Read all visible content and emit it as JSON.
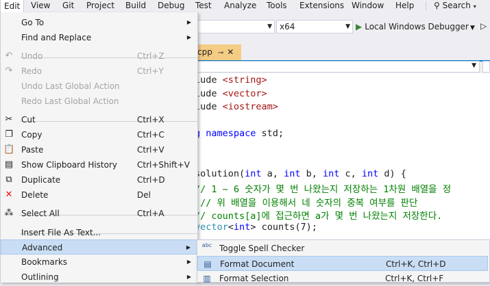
{
  "menubar": {
    "items": [
      "Edit",
      "View",
      "Git",
      "Project",
      "Build",
      "Debug",
      "Test",
      "Analyze",
      "Tools",
      "Extensions",
      "Window",
      "Help"
    ],
    "search": "Search"
  },
  "toolbar": {
    "config_value": "",
    "platform_value": "x64",
    "debugger_label": "Local Windows Debugger"
  },
  "editor": {
    "tab_label": "cpp",
    "code_lines": [
      {
        "parts": [
          [
            "",
            "lude "
          ],
          [
            "str",
            "<string>"
          ]
        ]
      },
      {
        "parts": [
          [
            "",
            "lude "
          ],
          [
            "str",
            "<vector>"
          ]
        ]
      },
      {
        "parts": [
          [
            "",
            "lude "
          ],
          [
            "str",
            "<iostream>"
          ]
        ]
      },
      {
        "parts": []
      },
      {
        "parts": [
          [
            "kw",
            "g namespace "
          ],
          [
            "",
            "std;"
          ]
        ]
      },
      {
        "parts": []
      },
      {
        "parts": []
      },
      {
        "parts": [
          [
            "",
            "solution("
          ],
          [
            "kw",
            "int"
          ],
          [
            "",
            " a, "
          ],
          [
            "kw",
            "int"
          ],
          [
            "",
            " b, "
          ],
          [
            "kw",
            "int"
          ],
          [
            "",
            " c, "
          ],
          [
            "kw",
            "int"
          ],
          [
            "",
            " d) {"
          ]
        ]
      },
      {
        "parts": [
          [
            "cm",
            "// 1 ~ 6 숫자가 몇 번 나왔는지 저장하는 1차원 배열을 정"
          ]
        ]
      },
      {
        "parts": [
          [
            "cm",
            " // 위 배열을 이용해서 네 숫자의 중복 여부를 판단"
          ]
        ]
      },
      {
        "parts": [
          [
            "cm",
            "// counts[a]에 접근하면 a가 몇 번 나왔는지 저장한다."
          ]
        ]
      },
      {
        "parts": [
          [
            "tp",
            "vector"
          ],
          [
            "",
            "<"
          ],
          [
            "kw",
            "int"
          ],
          [
            "",
            "> counts(7);"
          ]
        ]
      }
    ]
  },
  "edit_menu": {
    "items": [
      {
        "label": "Go To",
        "shortcut": "",
        "submenu": true,
        "icon": "",
        "disabled": false
      },
      {
        "label": "Find and Replace",
        "shortcut": "",
        "submenu": true,
        "icon": "",
        "disabled": false
      },
      {
        "label": "Undo",
        "shortcut": "Ctrl+Z",
        "submenu": false,
        "icon": "undo-icon",
        "disabled": true
      },
      {
        "label": "Redo",
        "shortcut": "Ctrl+Y",
        "submenu": false,
        "icon": "redo-icon",
        "disabled": true
      },
      {
        "label": "Undo Last Global Action",
        "shortcut": "",
        "submenu": false,
        "icon": "",
        "disabled": true
      },
      {
        "label": "Redo Last Global Action",
        "shortcut": "",
        "submenu": false,
        "icon": "",
        "disabled": true
      },
      {
        "label": "Cut",
        "shortcut": "Ctrl+X",
        "submenu": false,
        "icon": "cut-icon",
        "disabled": false
      },
      {
        "label": "Copy",
        "shortcut": "Ctrl+C",
        "submenu": false,
        "icon": "copy-icon",
        "disabled": false
      },
      {
        "label": "Paste",
        "shortcut": "Ctrl+V",
        "submenu": false,
        "icon": "paste-icon",
        "disabled": false
      },
      {
        "label": "Show Clipboard History",
        "shortcut": "Ctrl+Shift+V",
        "submenu": false,
        "icon": "clipboard-history-icon",
        "disabled": false
      },
      {
        "label": "Duplicate",
        "shortcut": "Ctrl+D",
        "submenu": false,
        "icon": "duplicate-icon",
        "disabled": false
      },
      {
        "label": "Delete",
        "shortcut": "Del",
        "submenu": false,
        "icon": "delete-icon",
        "disabled": false
      },
      {
        "label": "Select All",
        "shortcut": "Ctrl+A",
        "submenu": false,
        "icon": "select-all-icon",
        "disabled": false
      },
      {
        "label": "Insert File As Text...",
        "shortcut": "",
        "submenu": false,
        "icon": "",
        "disabled": false
      },
      {
        "label": "Advanced",
        "shortcut": "",
        "submenu": true,
        "icon": "",
        "disabled": false
      },
      {
        "label": "Bookmarks",
        "shortcut": "",
        "submenu": true,
        "icon": "",
        "disabled": false
      },
      {
        "label": "Outlining",
        "shortcut": "",
        "submenu": true,
        "icon": "",
        "disabled": false
      }
    ]
  },
  "advanced_submenu": {
    "items": [
      {
        "label": "Toggle Spell Checker",
        "shortcut": "",
        "icon": "spell-check-icon"
      },
      {
        "label": "Format Document",
        "shortcut": "Ctrl+K, Ctrl+D",
        "icon": "format-document-icon"
      },
      {
        "label": "Format Selection",
        "shortcut": "Ctrl+K, Ctrl+F",
        "icon": "format-selection-icon"
      }
    ]
  }
}
